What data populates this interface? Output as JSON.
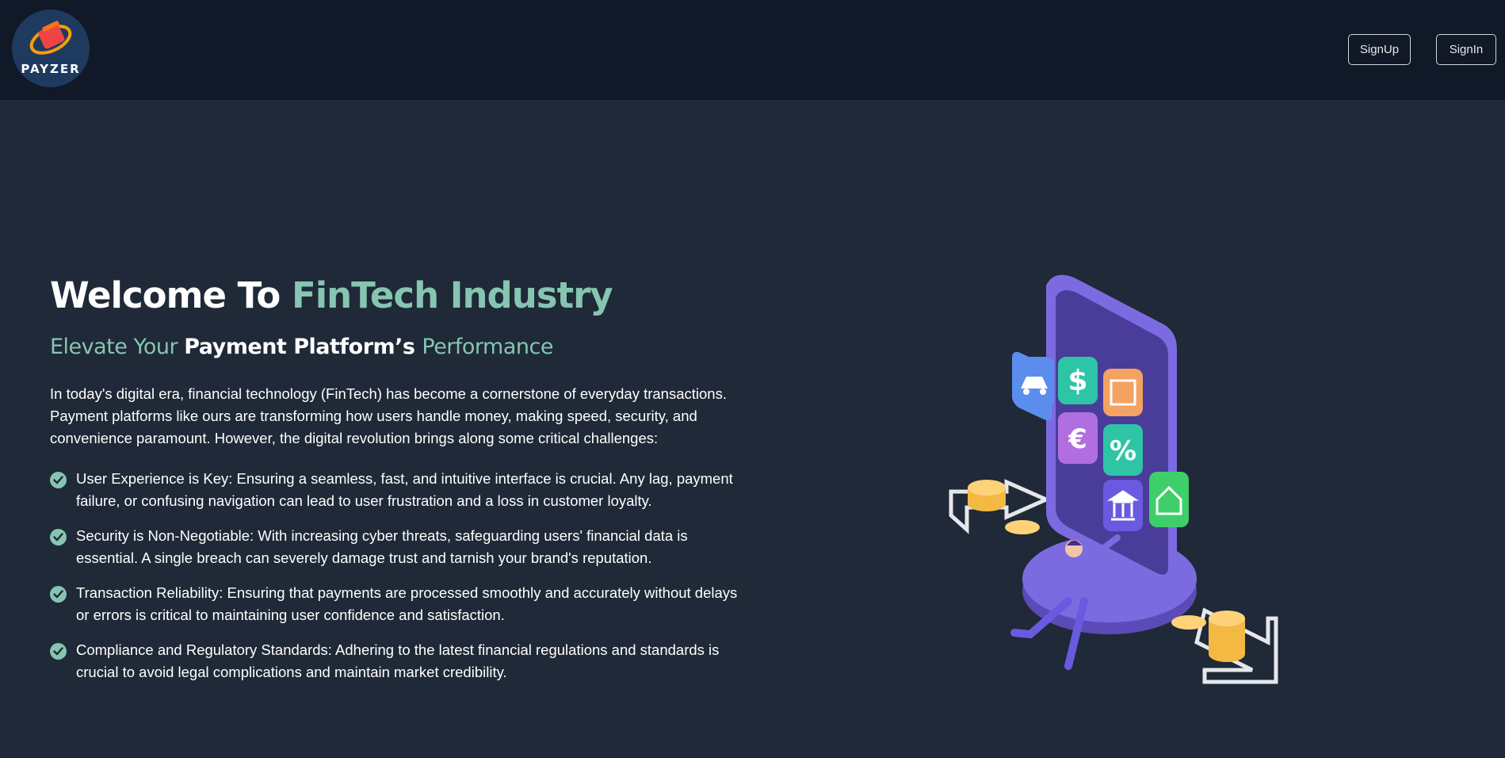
{
  "brand": {
    "name": "PAYZER",
    "logo_icon": "wallet-logo-icon"
  },
  "nav": {
    "signup_label": "SignUp",
    "signin_label": "SignIn"
  },
  "hero": {
    "title_prefix": "Welcome To ",
    "title_accent": "FinTech Industry",
    "subtitle_accent_1": "Elevate Your ",
    "subtitle_main": "Payment Platform’s ",
    "subtitle_accent_2": "Performance",
    "intro": "In today's digital era, financial technology (FinTech) has become a cornerstone of everyday transactions. Payment platforms like ours are transforming how users handle money, making speed, security, and convenience paramount. However, the digital revolution brings along some critical challenges:",
    "points": [
      "User Experience is Key: Ensuring a seamless, fast, and intuitive interface is crucial. Any lag, payment failure, or confusing navigation can lead to user frustration and a loss in customer loyalty.",
      "Security is Non-Negotiable: With increasing cyber threats, safeguarding users' financial data is essential. A single breach can severely damage trust and tarnish your brand's reputation.",
      "Transaction Reliability: Ensuring that payments are processed smoothly and accurately without delays or errors is critical to maintaining user confidence and satisfaction.",
      "Compliance and Regulatory Standards: Adhering to the latest financial regulations and standards is crucial to avoid legal complications and maintain market credibility."
    ]
  },
  "colors": {
    "background": "#1f2937",
    "topbar": "#111827",
    "accent": "#86c5b1",
    "button_border": "#cbd5e1"
  },
  "illustration": {
    "icon": "fintech-phone-illustration"
  }
}
